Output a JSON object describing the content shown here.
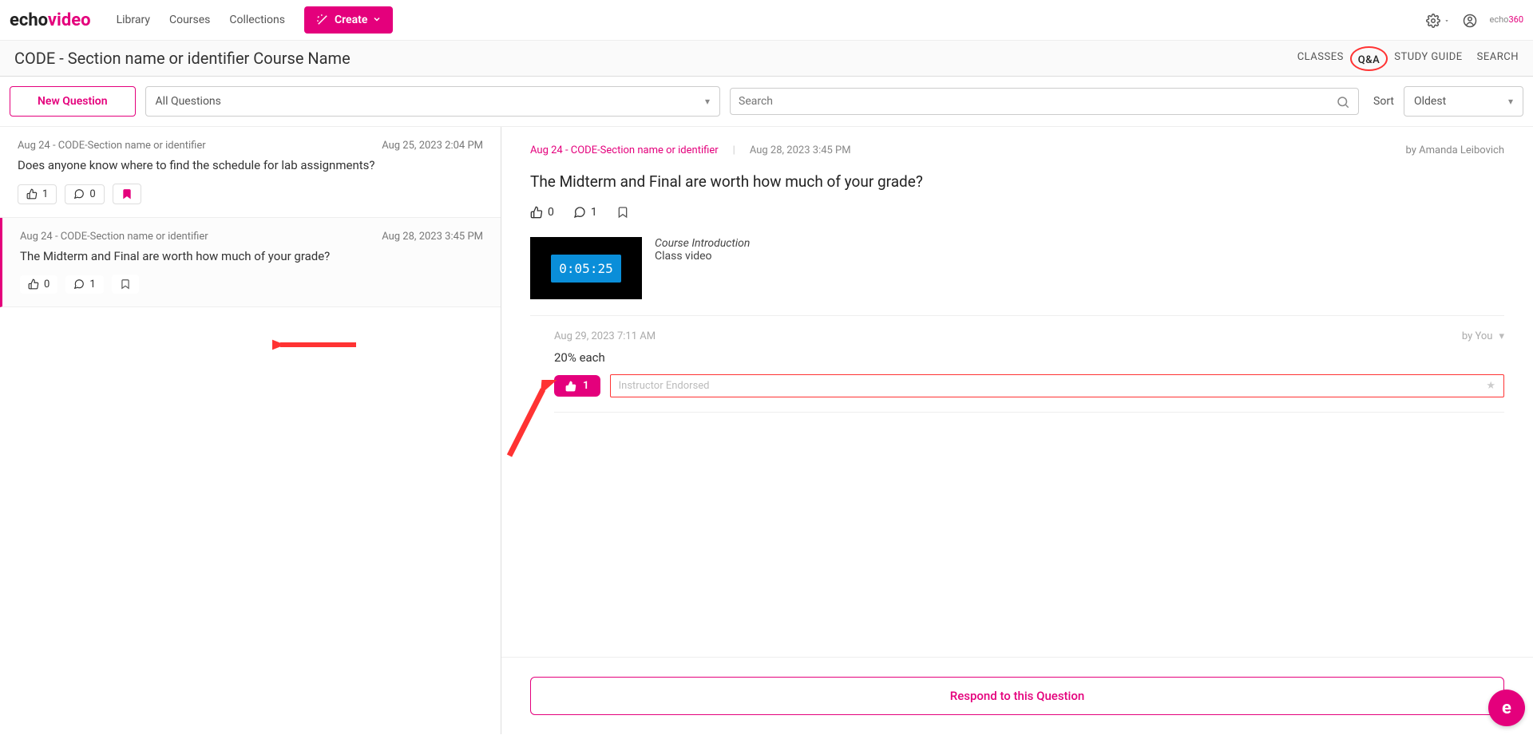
{
  "logo": {
    "part1": "echo",
    "part2": "video"
  },
  "nav": {
    "library": "Library",
    "courses": "Courses",
    "collections": "Collections",
    "create": "Create"
  },
  "header_right_logo": {
    "part1": "echo",
    "part2": "360"
  },
  "breadcrumb_title": "CODE - Section name or identifier Course Name",
  "tabs": {
    "classes": "CLASSES",
    "qa": "Q&A",
    "study": "STUDY GUIDE",
    "search": "SEARCH"
  },
  "toolbar": {
    "new_question": "New Question",
    "filter": "All Questions",
    "search_placeholder": "Search",
    "sort_label": "Sort",
    "sort_value": "Oldest"
  },
  "questions": [
    {
      "source": "Aug 24 - CODE-Section name or identifier",
      "date": "Aug 25, 2023 2:04 PM",
      "text": "Does anyone know where to find the schedule for lab assignments?",
      "likes": "1",
      "replies": "0",
      "bookmarked": true
    },
    {
      "source": "Aug 24 - CODE-Section name or identifier",
      "date": "Aug 28, 2023 3:45 PM",
      "text": "The Midterm and Final are worth how much of your grade?",
      "likes": "0",
      "replies": "1",
      "bookmarked": false
    }
  ],
  "detail": {
    "source": "Aug 24 - CODE-Section name or identifier",
    "date": "Aug 28, 2023 3:45 PM",
    "author": "by Amanda Leibovich",
    "question": "The Midterm and Final are worth how much of your grade?",
    "likes": "0",
    "replies": "1",
    "video": {
      "timecode": "0:05:25",
      "title": "Course Introduction",
      "subtitle": "Class video"
    },
    "response": {
      "date": "Aug 29, 2023 7:11 AM",
      "author": "by You",
      "text": "20% each",
      "likes": "1",
      "endorsed_label": "Instructor Endorsed"
    },
    "respond_button": "Respond to this Question"
  }
}
